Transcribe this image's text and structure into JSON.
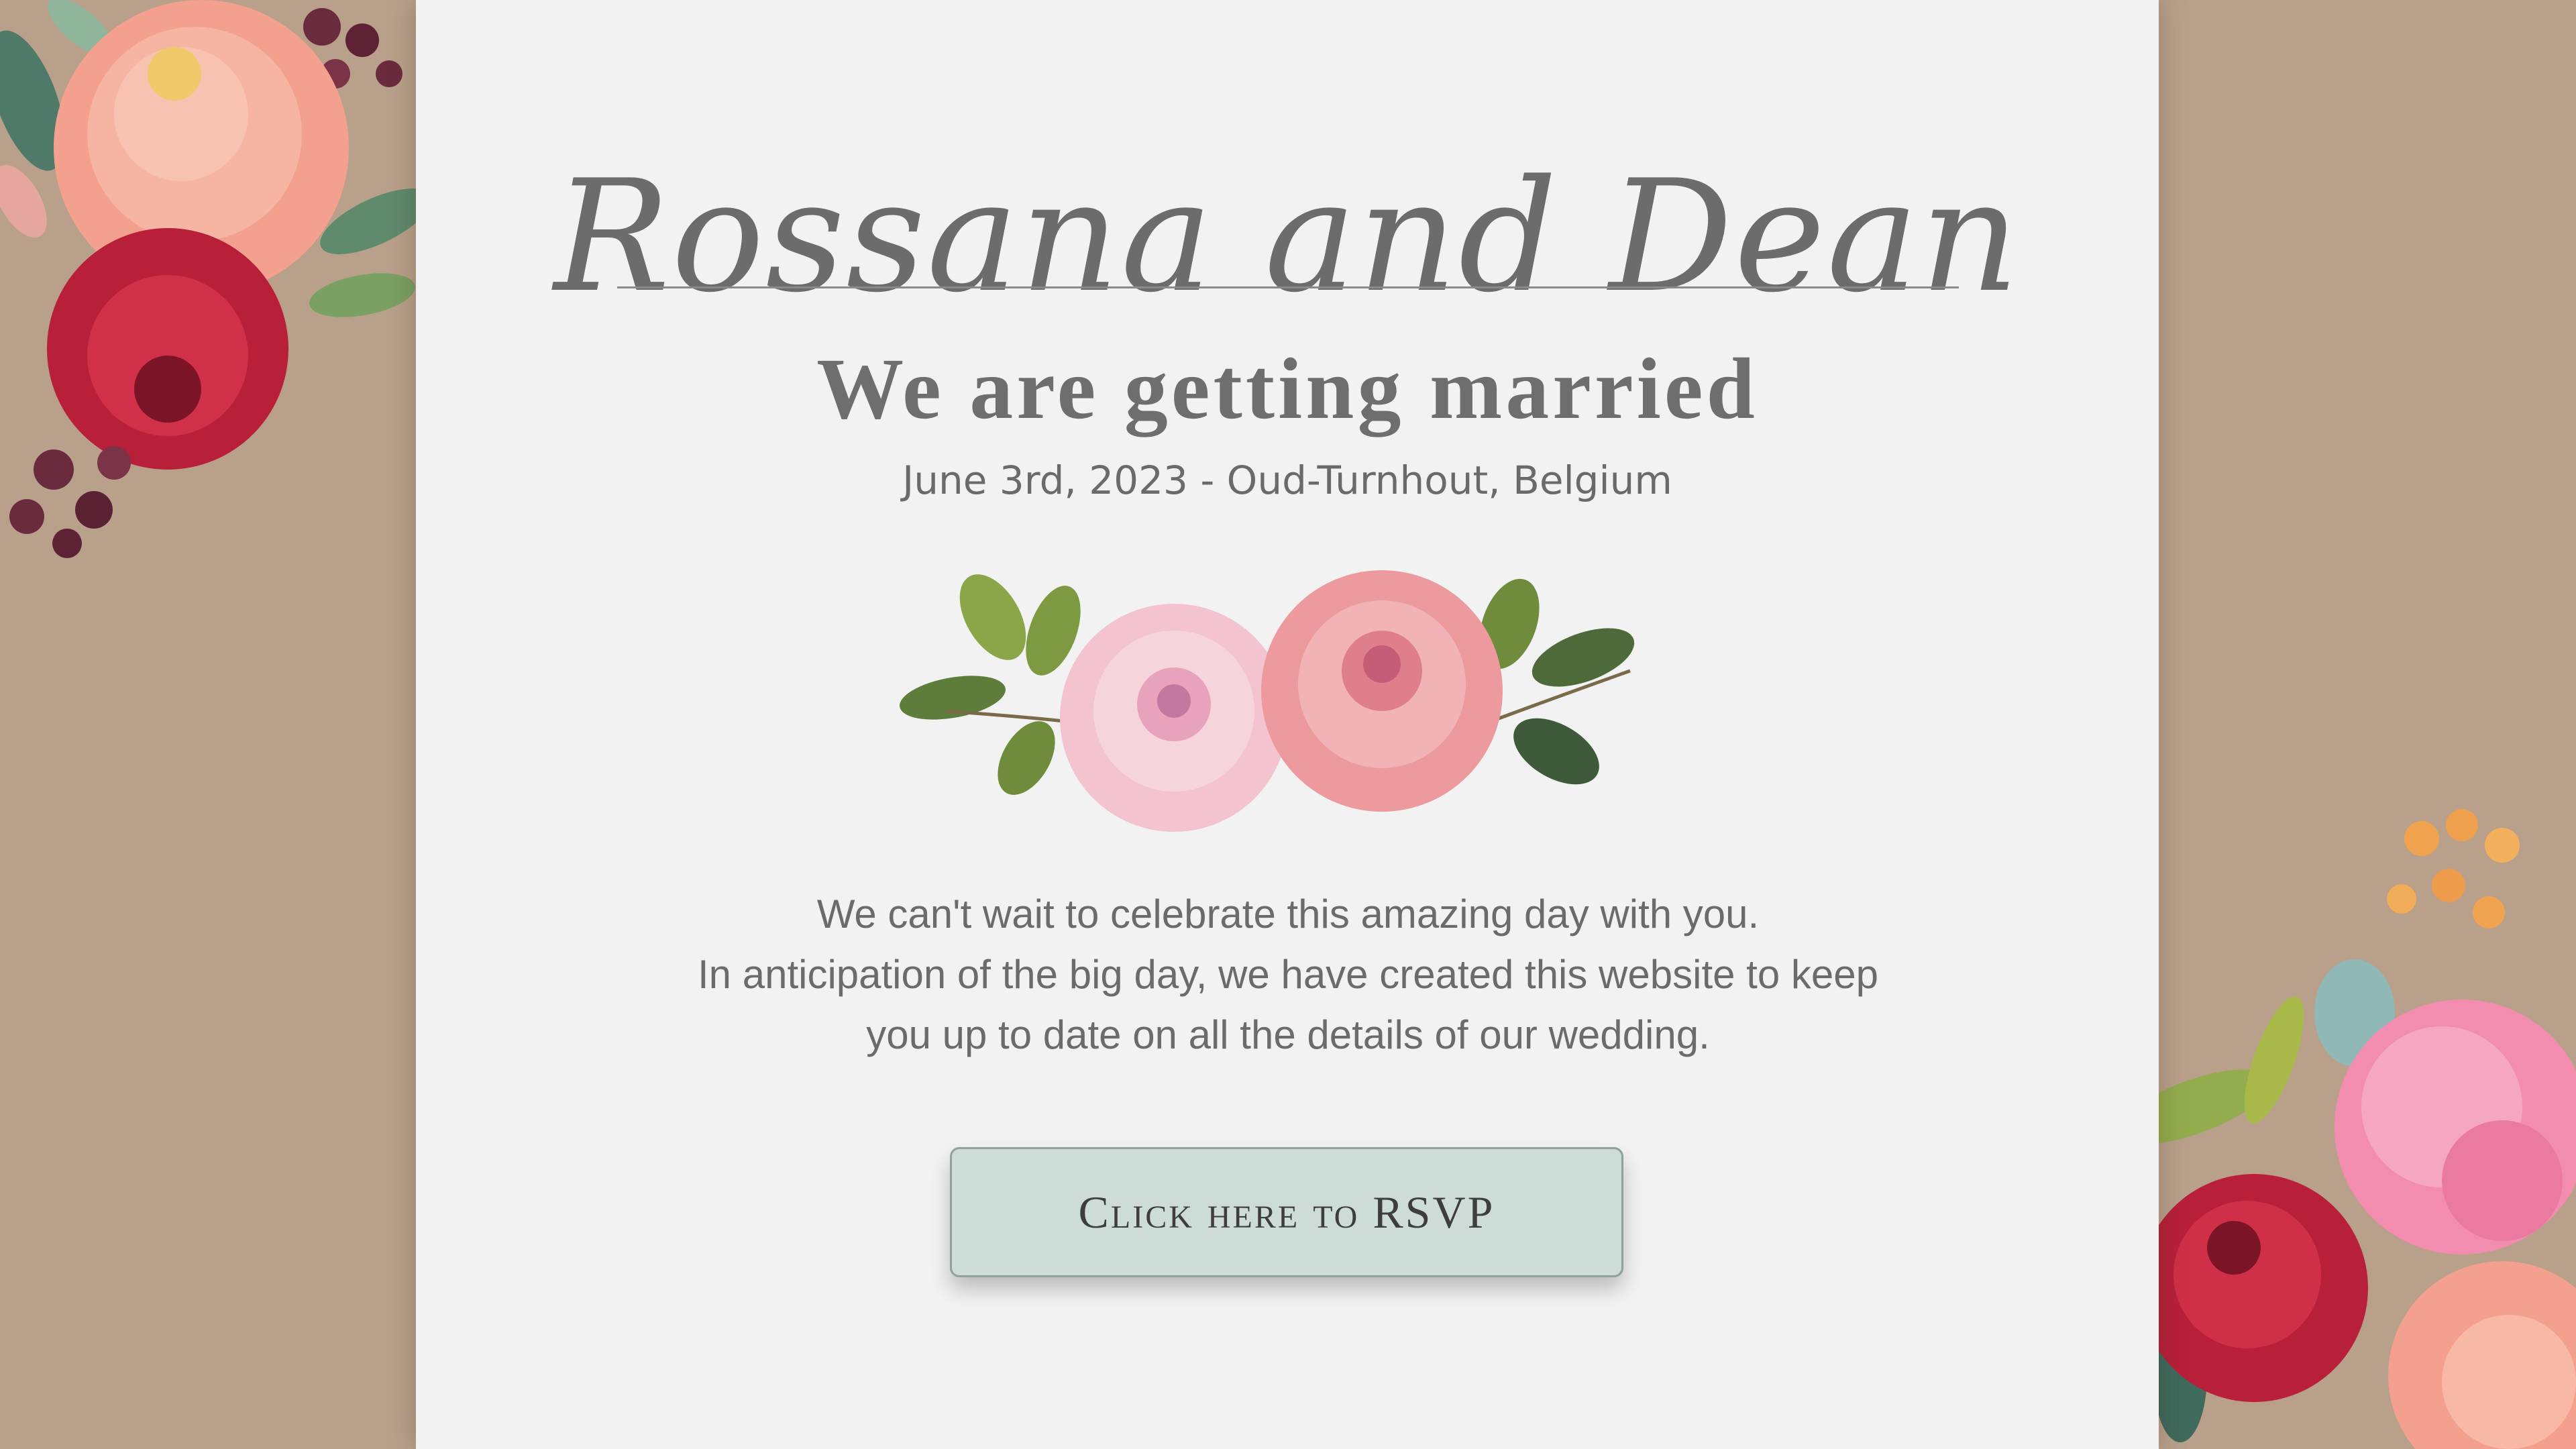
{
  "invitation": {
    "couple_name": "Rossana and Dean",
    "headline": "We are getting married",
    "date_location": "June 3rd, 2023 - Oud-Turnhout, Belgium",
    "message_lines": [
      "We can't wait to celebrate this amazing day with you.",
      "In anticipation of the big day, we have created this website to keep",
      "you up to date on all the details of our wedding."
    ],
    "rsvp_label": "Click here to RSVP"
  },
  "decor": {
    "left_corner": "watercolor-flowers-bouquet",
    "right_corner": "watercolor-flowers-bouquet",
    "center_divider": "watercolor-roses-with-leaves"
  },
  "colors": {
    "background": "#b9a08a",
    "card": "#f2f2f2",
    "text": "#6b6b6b",
    "button": "#cddcd7"
  }
}
